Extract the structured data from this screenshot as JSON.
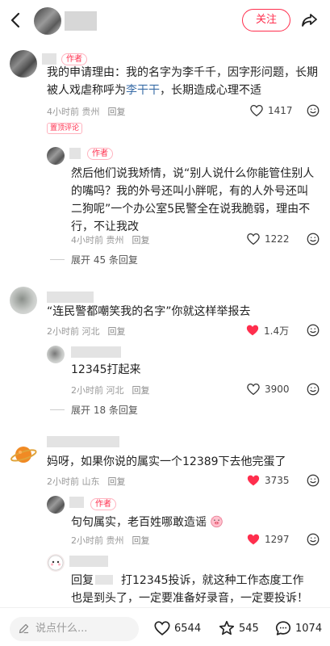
{
  "header": {
    "follow_label": "关注"
  },
  "comments": [
    {
      "author_tag": "作者",
      "text_a": "我的申请理由：我的名字为李千千，因字形问题，长期被人戏虐称呼为",
      "highlight": "李干干",
      "text_b": "，长期造成心理不适",
      "time": "4小时前 贵州",
      "reply": "回复",
      "likes": "1417",
      "pinned": "置顶评论",
      "sub": {
        "author_tag": "作者",
        "text": "然后他们说我矫情，说“别人说什么你能管住别人的嘴吗？我的外号还叫小胖呢，有的人外号还叫二狗呢”一个办公室5民警全在说我脆弱，理由不行，不让我改",
        "time": "4小时前 贵州",
        "reply": "回复",
        "likes": "1222"
      },
      "expand": "展开 45 条回复"
    },
    {
      "text": "“连民警都嘲笑我的名字”你就这样举报去",
      "time": "2小时前 河北",
      "reply": "回复",
      "likes": "1.4万",
      "sub": {
        "text": "12345打起来",
        "time": "2小时前 河北",
        "reply": "回复",
        "likes": "3900"
      },
      "expand": "展开 18 条回复"
    },
    {
      "text": "妈呀，如果你说的属实一个12389下去他完蛋了",
      "time": "2小时前 山东",
      "reply": "回复",
      "likes": "3735",
      "sub": {
        "author_tag": "作者",
        "text": "句句属实，老百姓哪敢造谣",
        "time": "2小时前 贵州",
        "reply": "回复",
        "likes": "1297"
      },
      "sub2": {
        "reply_prefix": "回复",
        "text": "打12345投诉，就这种工作态度工作也是到头了，一定要准备好录音，一定要投诉！姐妹对我的"
      }
    }
  ],
  "bottom": {
    "placeholder": "说点什么...",
    "likes": "6544",
    "stars": "545",
    "comments": "1074"
  },
  "colors": {
    "accent": "#ff2e4d",
    "highlight": "#3b6ea8"
  }
}
